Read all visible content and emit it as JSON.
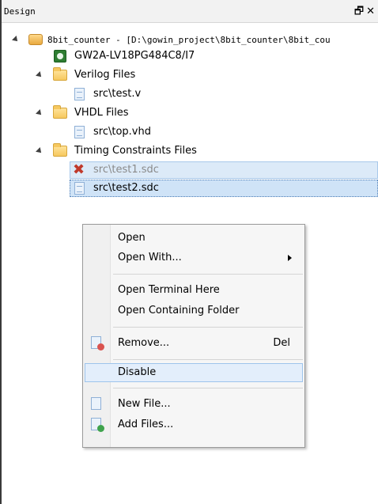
{
  "panel": {
    "title": "Design",
    "float_icon": "restore-icon",
    "close_icon": "close-icon"
  },
  "tree": {
    "project_label": "8bit_counter - [D:\\gowin_project\\8bit_counter\\8bit_cou",
    "device_label": "GW2A-LV18PG484C8/I7",
    "verilog_folder": "Verilog Files",
    "verilog_file": "src\\test.v",
    "vhdl_folder": "VHDL Files",
    "vhdl_file": "src\\top.vhd",
    "timing_folder": "Timing Constraints Files",
    "timing_file_1": "src\\test1.sdc",
    "timing_file_2": "src\\test2.sdc"
  },
  "context_menu": {
    "open": "Open",
    "open_with": "Open With...",
    "open_terminal": "Open Terminal Here",
    "open_folder": "Open Containing Folder",
    "remove": "Remove...",
    "remove_shortcut": "Del",
    "disable": "Disable",
    "new_file": "New File...",
    "add_files": "Add Files..."
  },
  "colors": {
    "selection": "#dceaf8",
    "menu_hover": "#e3eefb",
    "disabled_text": "#8a8a8a",
    "remove_badge": "#d9534f",
    "add_badge": "#3fa34d"
  }
}
